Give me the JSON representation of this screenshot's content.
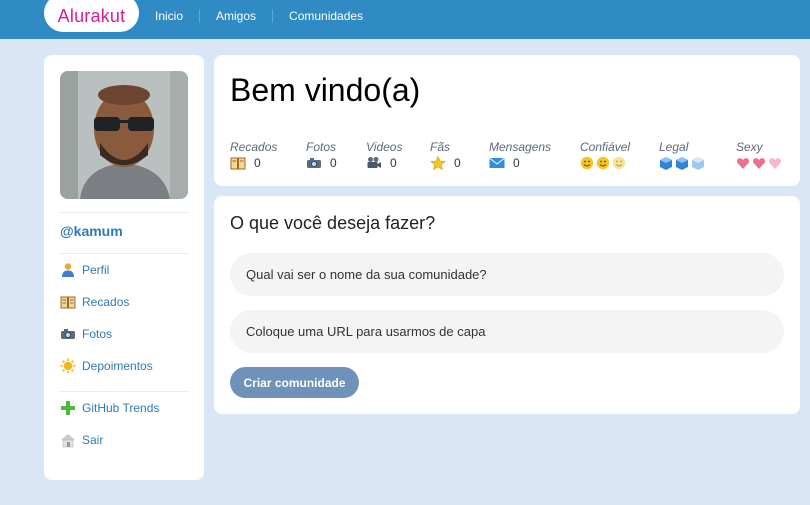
{
  "header": {
    "logo": "Alurakut",
    "nav": [
      "Inicio",
      "Amigos",
      "Comunidades"
    ]
  },
  "sidebar": {
    "username": "@kamum",
    "items": [
      {
        "label": "Perfil",
        "icon": "user-icon"
      },
      {
        "label": "Recados",
        "icon": "book-icon"
      },
      {
        "label": "Fotos",
        "icon": "camera-icon"
      },
      {
        "label": "Depoimentos",
        "icon": "sun-icon"
      },
      {
        "label": "GitHub Trends",
        "icon": "plus-icon"
      },
      {
        "label": "Sair",
        "icon": "house-icon"
      }
    ]
  },
  "welcome": {
    "title": "Bem vindo(a)",
    "stats": [
      {
        "label": "Recados",
        "value": "0",
        "icon": "book-icon"
      },
      {
        "label": "Fotos",
        "value": "0",
        "icon": "camera-icon"
      },
      {
        "label": "Videos",
        "value": "0",
        "icon": "video-camera-icon"
      },
      {
        "label": "Fãs",
        "value": "0",
        "icon": "star-icon"
      },
      {
        "label": "Mensagens",
        "value": "0",
        "icon": "mail-icon"
      }
    ],
    "ratings": [
      {
        "label": "Confiável",
        "icon": "smiley-icon",
        "count": 3,
        "filled": 2
      },
      {
        "label": "Legal",
        "icon": "ice-cube-icon",
        "count": 3,
        "filled": 2
      },
      {
        "label": "Sexy",
        "icon": "heart-icon",
        "count": 3,
        "filled": 2
      }
    ]
  },
  "form": {
    "title": "O que você deseja fazer?",
    "community_name_placeholder": "Qual vai ser o nome da sua comunidade?",
    "cover_url_placeholder": "Coloque uma URL para usarmos de capa",
    "submit_label": "Criar comunidade"
  },
  "colors": {
    "topbar": "#308bc5",
    "background": "#d9e6f6",
    "logo_text": "#d81d99",
    "link": "#2e7bb4",
    "button": "#6f92bb"
  }
}
